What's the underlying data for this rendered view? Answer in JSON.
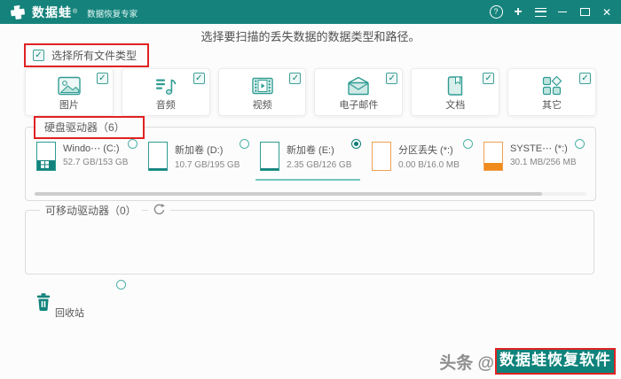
{
  "topbar": {
    "brand": "数据蛙",
    "brand_mark": "®",
    "subtitle": "数据恢复专家",
    "window_icons": [
      {
        "name": "help-icon"
      },
      {
        "name": "plus-icon"
      },
      {
        "name": "menu-icon"
      },
      {
        "name": "minimize-icon"
      },
      {
        "name": "maximize-icon"
      },
      {
        "name": "close-icon"
      }
    ]
  },
  "page": {
    "title": "选择要扫描的丢失数据的数据类型和路径。"
  },
  "select_all": {
    "label": "选择所有文件类型",
    "checked": true
  },
  "file_types": [
    {
      "label": "图片",
      "icon": "image-icon",
      "checked": true
    },
    {
      "label": "音频",
      "icon": "audio-icon",
      "checked": true
    },
    {
      "label": "视频",
      "icon": "video-icon",
      "checked": true
    },
    {
      "label": "电子邮件",
      "icon": "email-icon",
      "checked": true
    },
    {
      "label": "文档",
      "icon": "document-icon",
      "checked": true
    },
    {
      "label": "其它",
      "icon": "other-icon",
      "checked": true
    }
  ],
  "hard_drives": {
    "legend": "硬盘驱动器（6）",
    "scrollbar_thumb_percent": 92,
    "items": [
      {
        "name": "Windo⋯ (C:)",
        "capacity": "52.7 GB/153 GB",
        "color": "teal",
        "fill_percent": 34,
        "selected": false,
        "logo": "windows"
      },
      {
        "name": "新加卷 (D:)",
        "capacity": "10.7 GB/195 GB",
        "color": "teal",
        "fill_percent": 7,
        "selected": false
      },
      {
        "name": "新加卷 (E:)",
        "capacity": "2.35 GB/126 GB",
        "color": "teal",
        "fill_percent": 7,
        "selected": true
      },
      {
        "name": "分区丢失 (*:)",
        "capacity": "0.00 B/16.0 MB",
        "color": "orange",
        "fill_percent": 0,
        "selected": false
      },
      {
        "name": "SYSTE⋯ (*:)",
        "capacity": "30.1 MB/256 MB",
        "color": "orange",
        "fill_percent": 26,
        "selected": false
      }
    ]
  },
  "removable_drives": {
    "legend": "可移动驱动器（0）"
  },
  "recycle_bin": {
    "label": "回收站",
    "selected": false
  },
  "watermark": {
    "prefix": "头条 @",
    "button_label": "数据蛙恢复软件"
  },
  "colors": {
    "accent_teal": "#15837c",
    "accent_orange": "#ef8c1d",
    "annotation_red": "#e02222"
  }
}
